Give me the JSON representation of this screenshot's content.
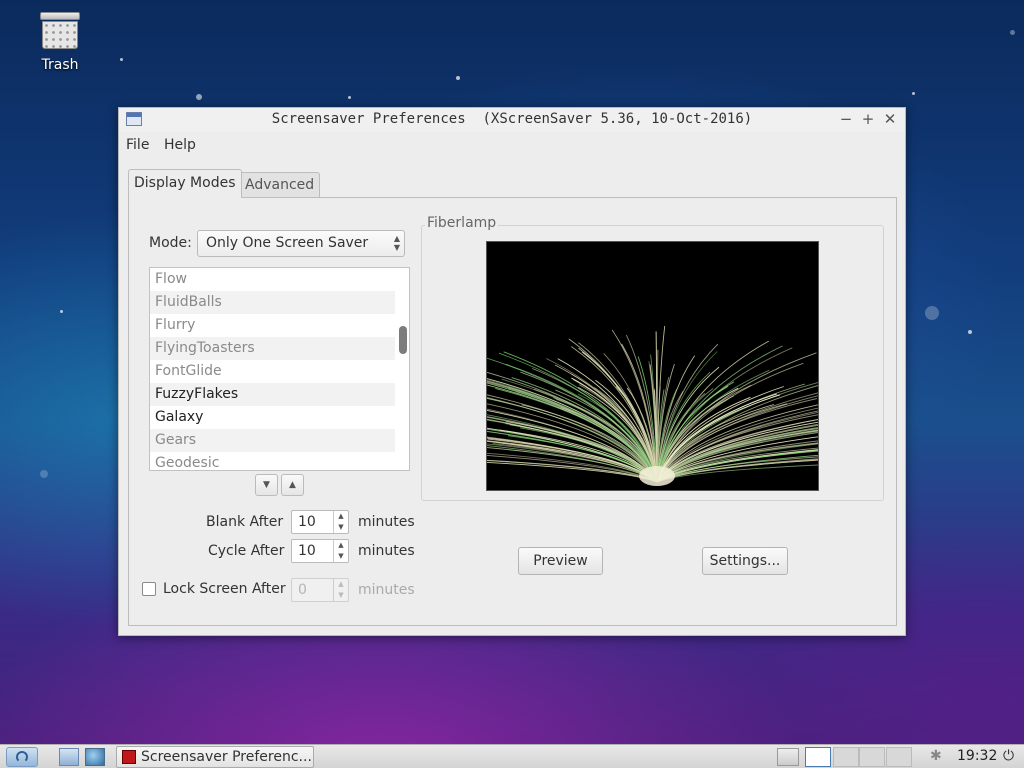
{
  "desktop": {
    "trash_label": "Trash"
  },
  "window": {
    "title": "Screensaver Preferences  (XScreenSaver 5.36, 10-Oct-2016)",
    "controls": {
      "minimize": "−",
      "maximize": "+",
      "close": "✕"
    }
  },
  "menubar": {
    "file": "File",
    "help": "Help"
  },
  "tabs": [
    {
      "label": "Display Modes",
      "active": true
    },
    {
      "label": "Advanced",
      "active": false
    }
  ],
  "mode": {
    "label": "Mode:",
    "value": "Only One Screen Saver"
  },
  "savers": {
    "items": [
      "Flow",
      "FluidBalls",
      "Flurry",
      "FlyingToasters",
      "FontGlide",
      "FuzzyFlakes",
      "Galaxy",
      "Gears",
      "Geodesic"
    ]
  },
  "list_nav": {
    "down": "▼",
    "up": "▲"
  },
  "timers": {
    "blank": {
      "label": "Blank After",
      "value": "10",
      "unit": "minutes"
    },
    "cycle": {
      "label": "Cycle After",
      "value": "10",
      "unit": "minutes"
    },
    "lock": {
      "label": "Lock Screen After",
      "value": "0",
      "unit": "minutes",
      "checked": false
    }
  },
  "preview": {
    "frame_title": "Fiberlamp",
    "preview_button": "Preview",
    "settings_button": "Settings..."
  },
  "taskbar": {
    "task_label": "Screensaver Preferenc...",
    "clock": "19:32",
    "power_glyph": "⏻",
    "bluetooth_glyph": "✱"
  }
}
